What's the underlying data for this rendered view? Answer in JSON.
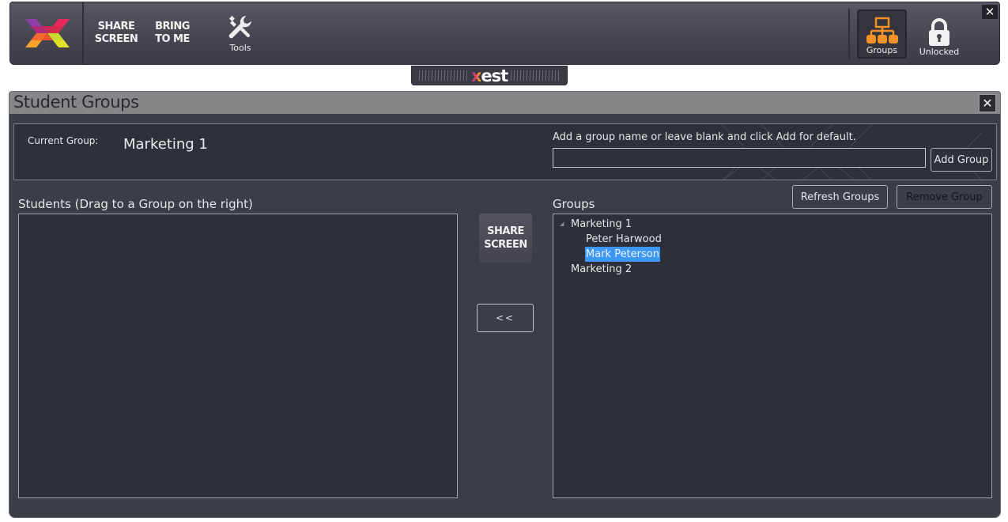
{
  "toolbar": {
    "logo_icon": "xest-x-logo-icon",
    "share_screen_line1": "SHARE",
    "share_screen_line2": "SCREEN",
    "bring_to_me_line1": "BRING",
    "bring_to_me_line2": "TO ME",
    "tools_label": "Tools",
    "tools_icon": "wrench-screwdriver-icon",
    "groups_label": "Groups",
    "groups_icon": "org-chart-icon",
    "groups_icon_color": "#f39227",
    "unlocked_label": "Unlocked",
    "unlocked_icon": "unlocked-padlock-icon",
    "close_label": "✕"
  },
  "xest_tab": {
    "brand_x": "x",
    "brand_rest": "est"
  },
  "dialog": {
    "title": "Student Groups",
    "close_label": "✕",
    "current_group_label": "Current Group:",
    "current_group_value": "Marketing 1",
    "add_hint": "Add a group name or leave blank and click Add for default.",
    "add_input_value": "",
    "add_input_placeholder": "",
    "add_group_button": "Add Group",
    "students_label": "Students (Drag to a Group on the right)",
    "students": [],
    "groups_label": "Groups",
    "refresh_groups_button": "Refresh Groups",
    "remove_group_button": "Remove Group",
    "share_screen_line1": "SHARE",
    "share_screen_line2": "SCREEN",
    "move_left_button": "<<",
    "groups_tree": [
      {
        "name": "Marketing 1",
        "expanded": true,
        "members": [
          {
            "name": "Peter Harwood",
            "selected": false
          },
          {
            "name": "Mark Peterson",
            "selected": true
          }
        ]
      },
      {
        "name": "Marketing 2",
        "expanded": false,
        "members": []
      }
    ],
    "selection_color": "#3d98f5"
  }
}
